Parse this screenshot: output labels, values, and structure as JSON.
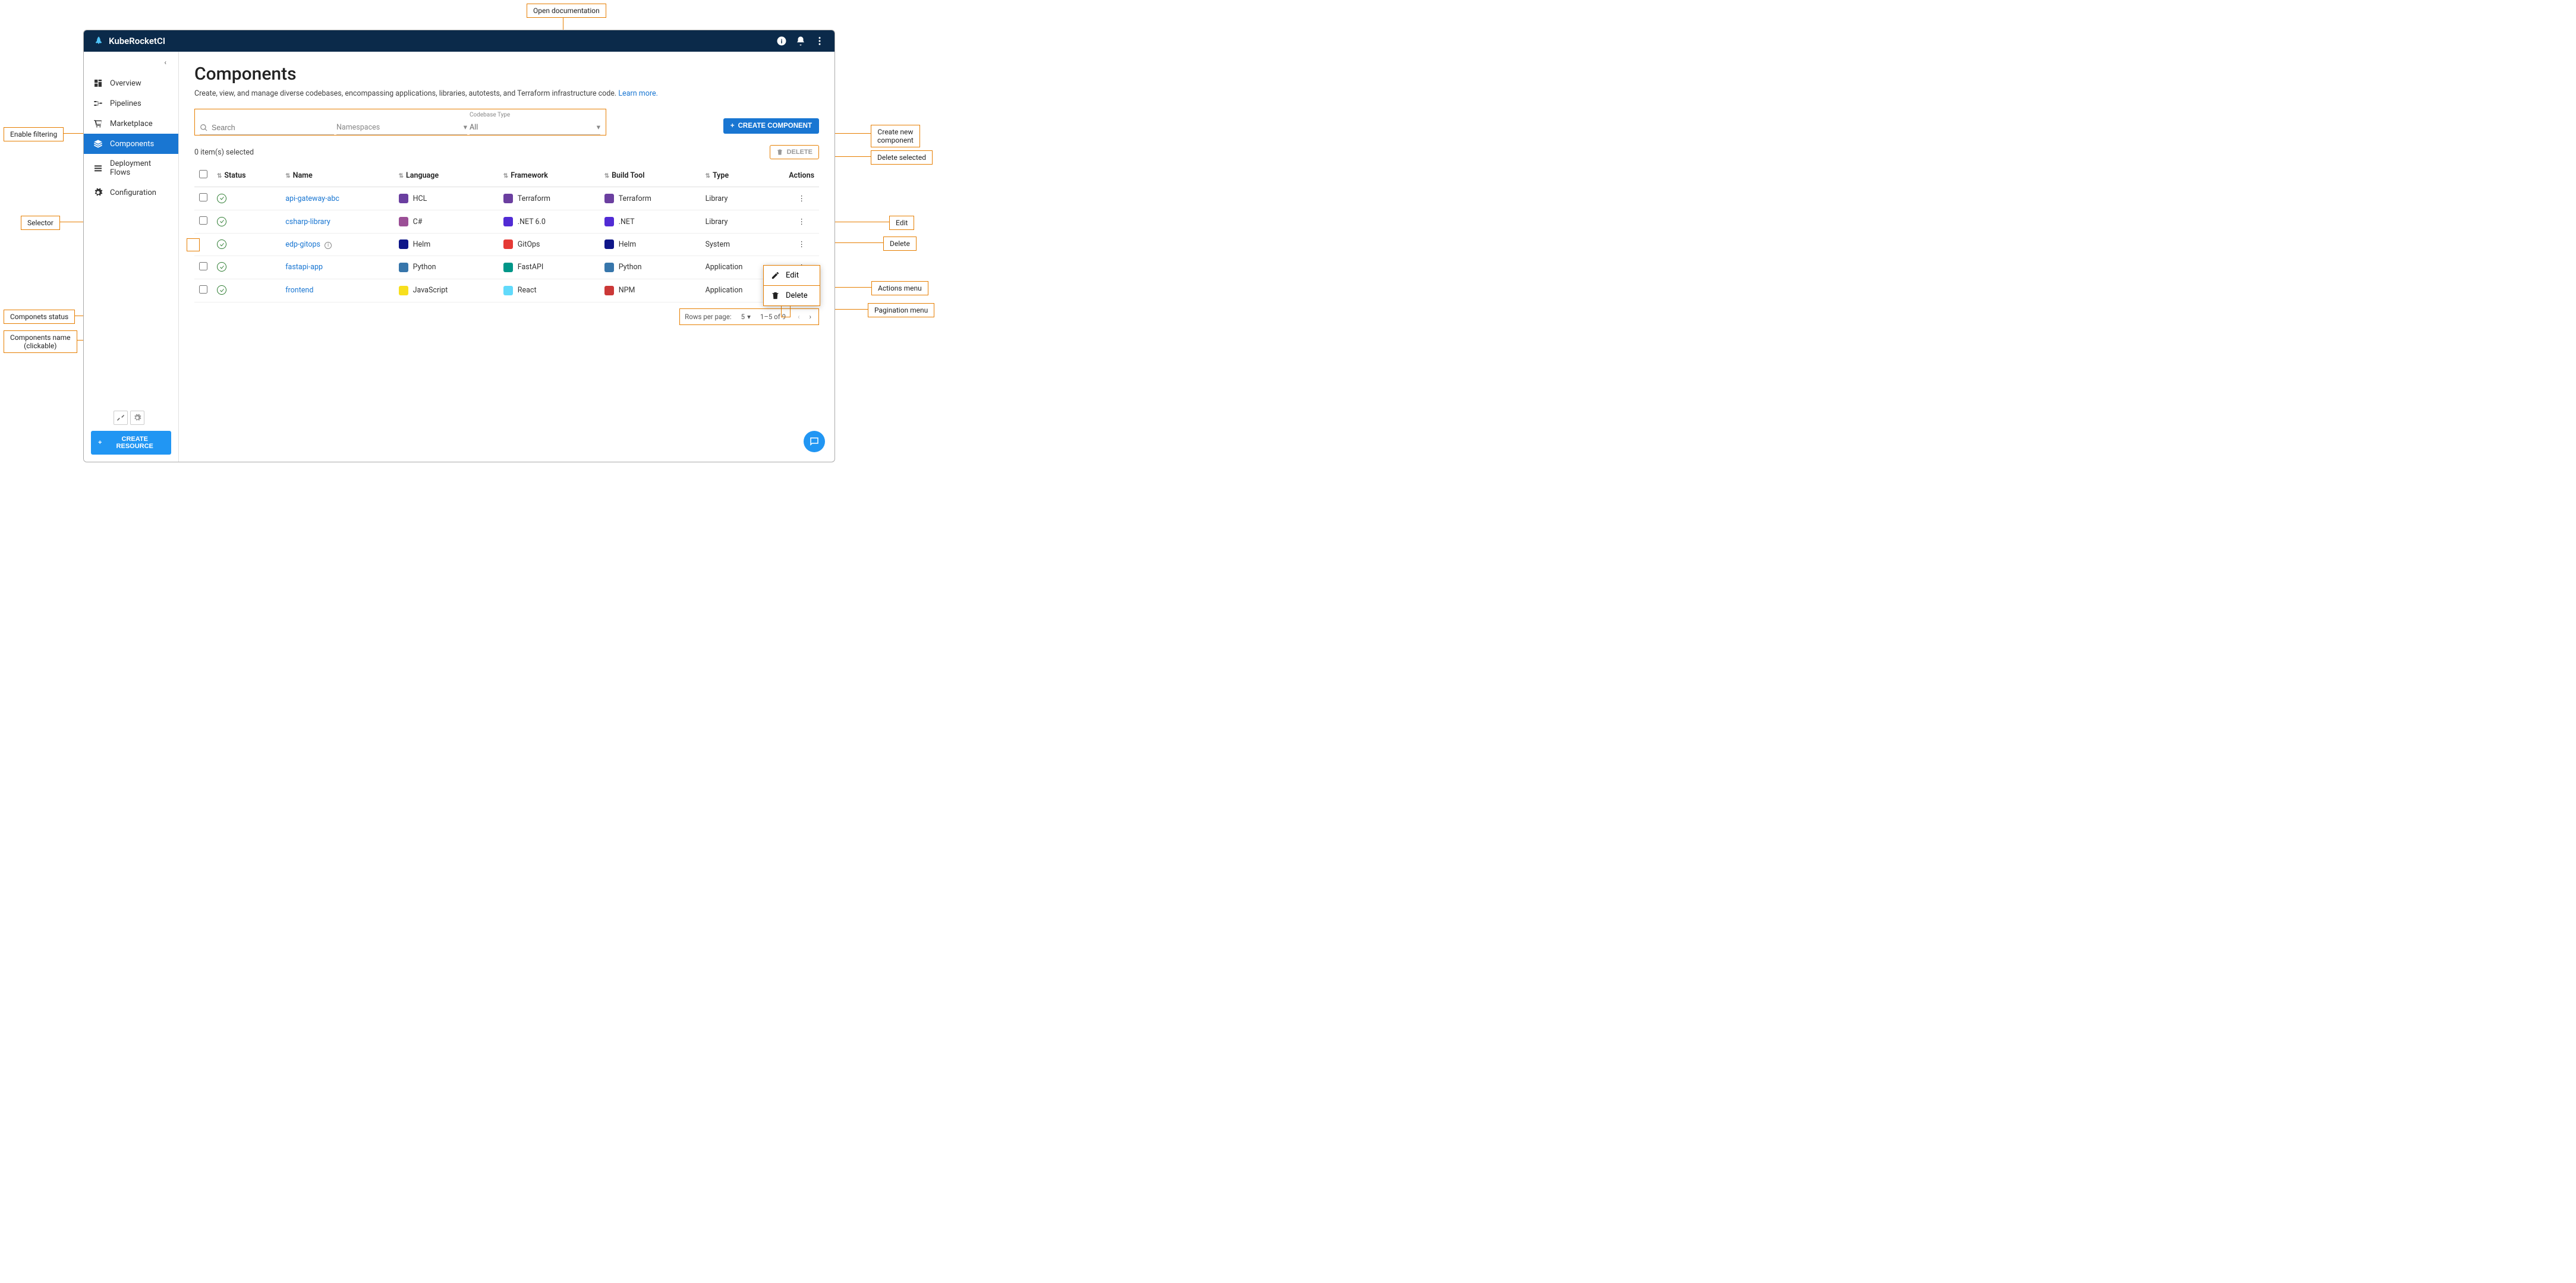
{
  "header": {
    "brand": "KubeRocketCI"
  },
  "sidebar": {
    "items": [
      {
        "label": "Overview",
        "icon": "dashboard"
      },
      {
        "label": "Pipelines",
        "icon": "pipelines"
      },
      {
        "label": "Marketplace",
        "icon": "cart"
      },
      {
        "label": "Components",
        "icon": "layers",
        "active": true
      },
      {
        "label": "Deployment Flows",
        "icon": "flows"
      },
      {
        "label": "Configuration",
        "icon": "gear"
      }
    ],
    "create_resource": "CREATE RESOURCE"
  },
  "page": {
    "title": "Components",
    "subtitle": "Create, view, and manage diverse codebases, encompassing applications, libraries, autotests, and Terraform infrastructure code.",
    "learn_more": "Learn more."
  },
  "filters": {
    "search_placeholder": "Search",
    "namespaces_label": "Namespaces",
    "codebase_type_label": "Codebase Type",
    "codebase_type_value": "All"
  },
  "actions": {
    "create_component": "CREATE COMPONENT",
    "delete": "DELETE"
  },
  "selection": {
    "text": "0 item(s) selected"
  },
  "table": {
    "headers": {
      "status": "Status",
      "name": "Name",
      "language": "Language",
      "framework": "Framework",
      "buildtool": "Build Tool",
      "type": "Type",
      "actions": "Actions"
    },
    "rows": [
      {
        "name": "api-gateway-abc",
        "language": "HCL",
        "lang_color": "#6b3fa0",
        "framework": "Terraform",
        "fw_color": "#6b3fa0",
        "buildtool": "Terraform",
        "bt_color": "#6b3fa0",
        "type": "Library",
        "checkbox": true
      },
      {
        "name": "csharp-library",
        "language": "C#",
        "lang_color": "#9b4f96",
        "framework": ".NET 6.0",
        "fw_color": "#512bd4",
        "buildtool": ".NET",
        "bt_color": "#512bd4",
        "type": "Library",
        "checkbox": true
      },
      {
        "name": "edp-gitops",
        "language": "Helm",
        "lang_color": "#0f1689",
        "framework": "GitOps",
        "fw_color": "#e53935",
        "buildtool": "Helm",
        "bt_color": "#0f1689",
        "type": "System",
        "checkbox": false,
        "info": true
      },
      {
        "name": "fastapi-app",
        "language": "Python",
        "lang_color": "#3776ab",
        "framework": "FastAPI",
        "fw_color": "#009688",
        "buildtool": "Python",
        "bt_color": "#3776ab",
        "type": "Application",
        "checkbox": true
      },
      {
        "name": "frontend",
        "language": "JavaScript",
        "lang_color": "#f7df1e",
        "framework": "React",
        "fw_color": "#61dafb",
        "buildtool": "NPM",
        "bt_color": "#cb3837",
        "type": "Application",
        "checkbox": true
      }
    ]
  },
  "context_menu": {
    "edit": "Edit",
    "delete": "Delete"
  },
  "pagination": {
    "rows_per_page_label": "Rows per page:",
    "rows_per_page_value": "5",
    "range": "1–5 of 9"
  },
  "callouts": {
    "open_doc": "Open documentation",
    "enable_filtering": "Enable filtering",
    "selector": "Selector",
    "components_status": "Componets status",
    "components_name": "Components name\n(clickable)",
    "create_new": "Create new\ncomponent",
    "delete_selected": "Delete selected",
    "edit": "Edit",
    "delete": "Delete",
    "actions_menu": "Actions menu",
    "pagination_menu": "Pagination menu"
  }
}
